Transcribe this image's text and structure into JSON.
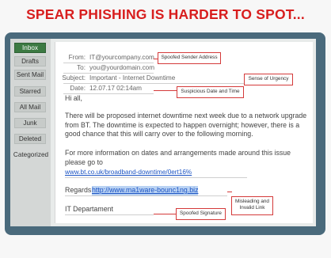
{
  "headline": "SPEAR PHISHING IS HARDER TO SPOT...",
  "colors": {
    "headline": "#d81e1e",
    "frame": "#4a6a7c",
    "active_folder": "#3c7a43",
    "callout_border": "#d43a3a",
    "link": "#1d55c4"
  },
  "sidebar": {
    "folders": [
      "Inbox",
      "Drafts",
      "Sent Mail",
      "Starred",
      "All Mail",
      "Junk",
      "Deleted",
      "Categorized"
    ],
    "active": "Inbox"
  },
  "email": {
    "from_label": "From:",
    "from_value": "IT@yourcompany.com",
    "to_label": "To:",
    "to_value": "you@yourdomain.com",
    "subject_label": "Subject:",
    "subject_value": "Important - Internet Downtime",
    "date_label": "Date:",
    "date_value": "12.07.17 02:14am",
    "greeting": "Hi all,",
    "paragraph1": "There will be proposed internet downtime next week due to a network upgrade from BT. The downtime is expected to happen overnight; however, there is a good chance that this will carry over to the following morning.",
    "paragraph2": "For more information on dates and arrangements made around this issue please go to",
    "info_link": "www.bt.co.uk/broadband-downtime/0ert16%",
    "regards_prefix": "Regards,",
    "malicious_link": "http://www.ma1ware-bounc1ng.biz",
    "signature": "IT Departament"
  },
  "callouts": {
    "sender": "Spoofed Sender Address",
    "urgency": "Sense of Urgency",
    "date": "Suspicious Date and Time",
    "link": "Misleading and Invalid Link",
    "signature": "Spoofed Signature"
  }
}
